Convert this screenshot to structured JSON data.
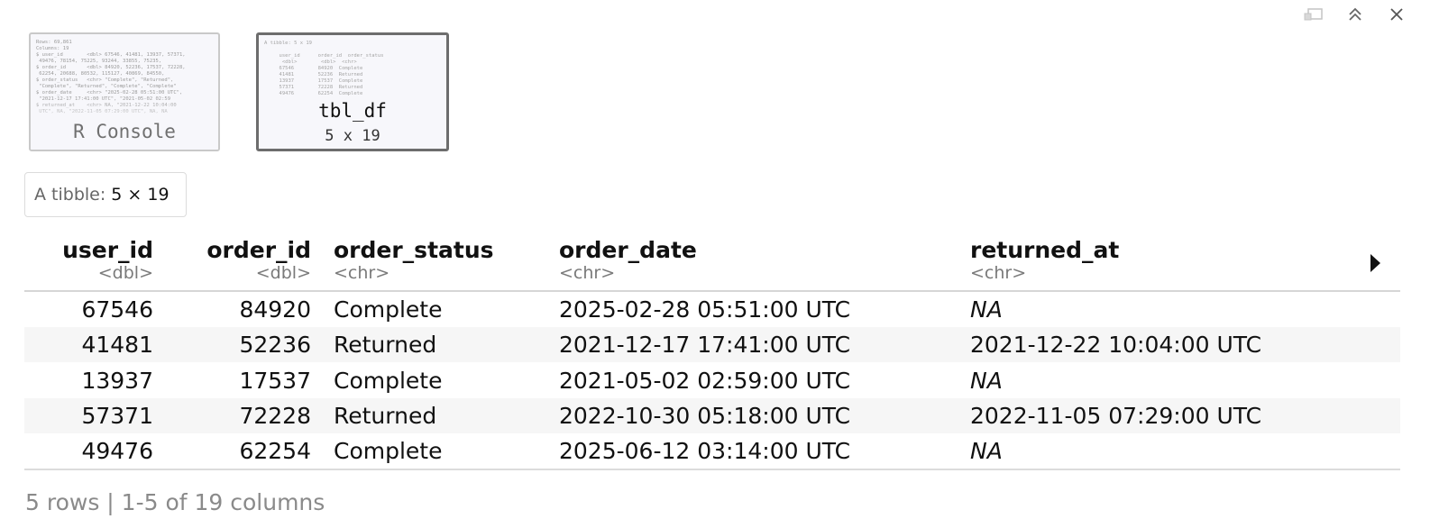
{
  "thumbnails": {
    "console": {
      "label": "R Console",
      "preview": "Rows: 69,861\nColumns: 19\n$ user_id        <dbl> 67546, 41481, 13937, 57371,\n 49476, 78154, 75225, 93244, 33855, 75235,\n$ order_id       <dbl> 84920, 52236, 17537, 72228,\n 62254, 20688, 80532, 115127, 40869, 84550,\n$ order_status   <chr> \"Complete\", \"Returned\",\n \"Complete\", \"Returned\", \"Complete\", \"Complete\"\n$ order_date     <chr> \"2025-02-28 05:51:00 UTC\",\n \"2021-12-17 17:41:00 UTC\", \"2021-05-02 02:59\n$ returned_at    <chr> NA, \"2021-12-22 10:04:00\n UTC\", NA, \"2022-11-05 07:29:00 UTC\", NA, NA"
    },
    "tbl_df": {
      "name": "tbl_df",
      "dims": "5 x 19",
      "preview": "A tibble: 5 x 19\n\n     user_id      order_id  order_status\n      <dbl>        <dbl>  <chr>\n     67546        84920  Complete\n     41481        52236  Returned\n     13937        17537  Complete\n     57371        72228  Returned\n     49476        62254  Complete\n\n5 rows | 1-5 of 19 columns"
    }
  },
  "tibble": {
    "prefix": "A tibble:",
    "dims": "5 × 19"
  },
  "columns": [
    {
      "name": "user_id",
      "type": "<dbl>"
    },
    {
      "name": "order_id",
      "type": "<dbl>"
    },
    {
      "name": "order_status",
      "type": "<chr>"
    },
    {
      "name": "order_date",
      "type": "<chr>"
    },
    {
      "name": "returned_at",
      "type": "<chr>"
    }
  ],
  "rows": [
    [
      "67546",
      "84920",
      "Complete",
      "2025-02-28 05:51:00 UTC",
      "NA"
    ],
    [
      "41481",
      "52236",
      "Returned",
      "2021-12-17 17:41:00 UTC",
      "2021-12-22 10:04:00 UTC"
    ],
    [
      "13937",
      "17537",
      "Complete",
      "2021-05-02 02:59:00 UTC",
      "NA"
    ],
    [
      "57371",
      "72228",
      "Returned",
      "2022-10-30 05:18:00 UTC",
      "2022-11-05 07:29:00 UTC"
    ],
    [
      "49476",
      "62254",
      "Complete",
      "2025-06-12 03:14:00 UTC",
      "NA"
    ]
  ],
  "footer": "5 rows | 1-5 of 19 columns",
  "icons": {
    "pin": "pin-icon",
    "collapse": "double-chevron-up-icon",
    "close": "close-icon",
    "next_columns": "triangle-right-icon"
  },
  "colors": {
    "na_text": "#b0b0b0",
    "header_type": "#7a7a7a",
    "footer_text": "#8a8a8a",
    "stripe": "#f6f6f6"
  }
}
